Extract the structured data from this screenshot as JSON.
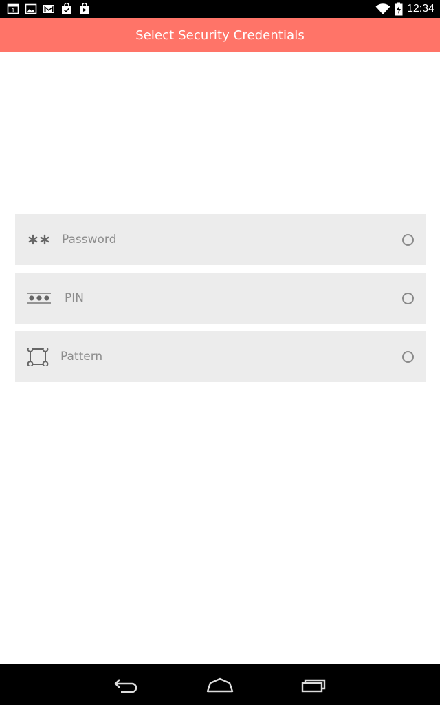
{
  "status_bar": {
    "time": "12:34",
    "notification_icons": [
      "calendar-icon",
      "image-icon",
      "gmail-icon",
      "shopping-bag-icon",
      "play-store-bag-icon"
    ],
    "wifi_icon": "wifi-icon",
    "battery_icon": "battery-charging-icon"
  },
  "app_bar": {
    "title": "Select Security Credentials",
    "color": "#ff7468"
  },
  "options": [
    {
      "label": "Password",
      "icon": "asterisks-icon",
      "selected": false
    },
    {
      "label": "PIN",
      "icon": "pin-dots-icon",
      "selected": false
    },
    {
      "label": "Pattern",
      "icon": "pattern-grid-icon",
      "selected": false
    }
  ],
  "nav_bar": {
    "buttons": [
      "back-icon",
      "home-icon",
      "recent-apps-icon"
    ]
  }
}
